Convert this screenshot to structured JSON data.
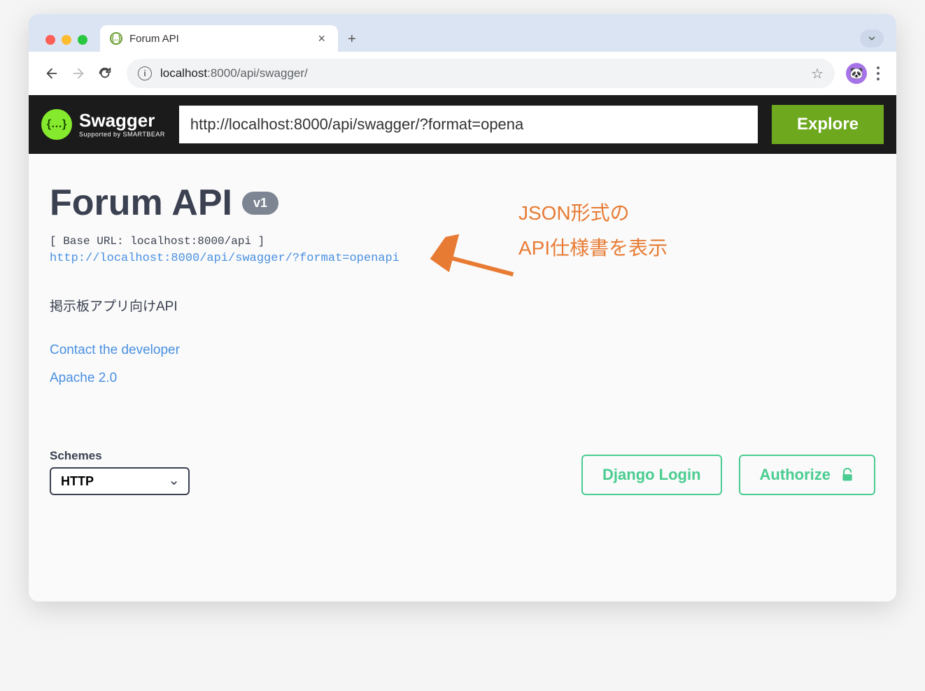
{
  "browser": {
    "tab_title": "Forum API",
    "url_host": "localhost",
    "url_port_path": ":8000/api/swagger/"
  },
  "swagger": {
    "brand_main": "Swagger",
    "brand_sub": "Supported by SMARTBEAR",
    "spec_url_input": "http://localhost:8000/api/swagger/?format=opena",
    "explore_label": "Explore"
  },
  "api": {
    "title": "Forum API",
    "version": "v1",
    "base_url_label": "[ Base URL: localhost:8000/api ]",
    "spec_link": "http://localhost:8000/api/swagger/?format=openapi",
    "description": "掲示板アプリ向けAPI",
    "contact_label": "Contact the developer",
    "license_label": "Apache 2.0"
  },
  "annotation": {
    "line1": "JSON形式の",
    "line2": "API仕様書を表示"
  },
  "controls": {
    "schemes_label": "Schemes",
    "scheme_value": "HTTP",
    "django_login_label": "Django Login",
    "authorize_label": "Authorize"
  }
}
